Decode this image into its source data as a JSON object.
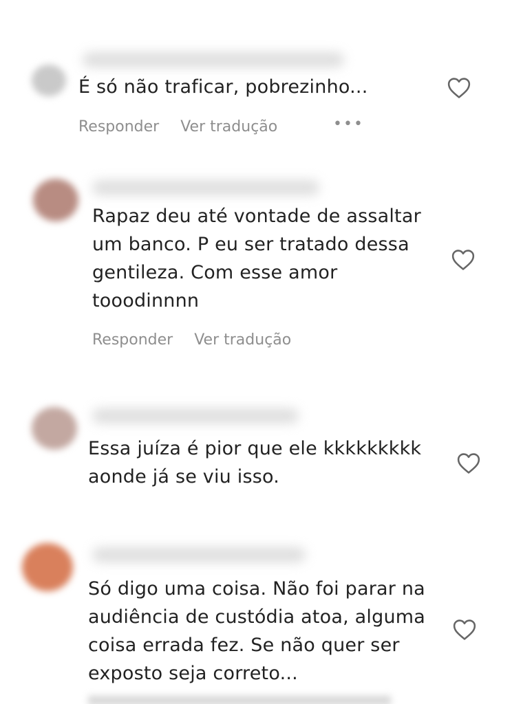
{
  "comments": [
    {
      "text_lines": [
        "É só não traficar, pobrezinho..."
      ],
      "reply_label": "Responder",
      "translate_label": "Ver tradução",
      "more_label": "•••",
      "avatar_color": "#c8c8c8"
    },
    {
      "text_lines": [
        "Rapaz deu até vontade de assaltar",
        "um banco. P eu ser tratado dessa",
        "gentileza. Com esse amor",
        "tooodinnnn"
      ],
      "reply_label": "Responder",
      "translate_label": "Ver tradução",
      "avatar_color": "#b98f86"
    },
    {
      "text_lines": [
        "Essa juíza é pior que ele kkkkkkkkk",
        "aonde já se viu isso."
      ],
      "avatar_color": "#c4a9a3"
    },
    {
      "text_lines": [
        "Só digo uma coisa. Não foi parar na",
        "audiência de custódia atoa, alguma",
        "coisa errada fez. Se não quer ser",
        "exposto seja correto..."
      ],
      "avatar_color": "#d9825f"
    }
  ],
  "icons": {
    "like": "heart-outline-icon"
  },
  "colors": {
    "text": "#262626",
    "secondary": "#8e8e8e"
  }
}
